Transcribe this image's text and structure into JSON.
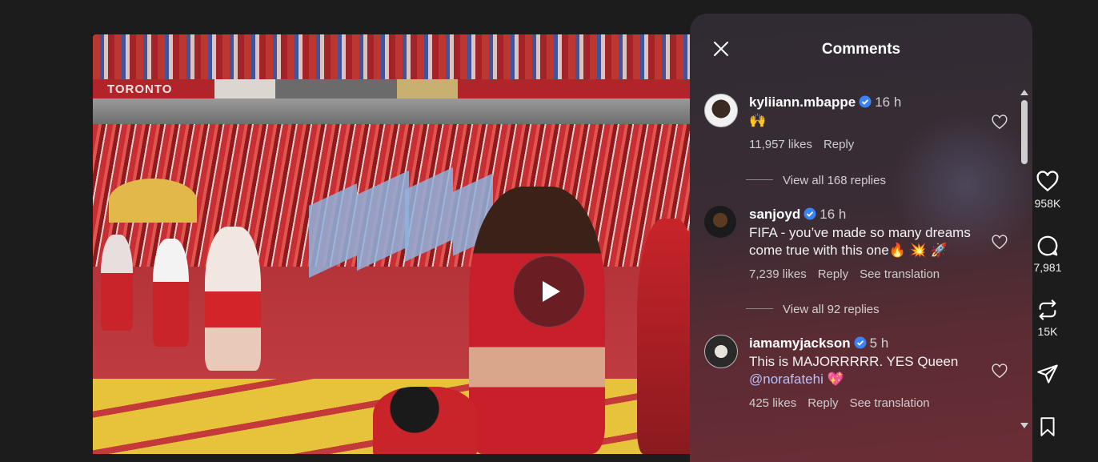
{
  "video": {
    "banner_text": "TORONTO"
  },
  "panel": {
    "title": "Comments"
  },
  "comments": [
    {
      "username": "kyliiann.mbappe",
      "time": "16 h",
      "text": "🙌",
      "likes": "11,957 likes",
      "reply": "Reply",
      "view_replies": "View all 168 replies"
    },
    {
      "username": "sanjoyd",
      "time": "16 h",
      "text": "FIFA - you’ve made so many dreams come true with this one🔥 💥 🚀",
      "likes": "7,239 likes",
      "reply": "Reply",
      "translation": "See translation",
      "view_replies": "View all 92 replies"
    },
    {
      "username": "iamamyjackson",
      "time": "5 h",
      "text": "This is MAJORRRRR. YES Queen ",
      "mention": "@norafatehi",
      "emoji": "💖",
      "likes": "425 likes",
      "reply": "Reply",
      "translation": "See translation"
    }
  ],
  "actions": {
    "like_count": "958K",
    "comment_count": "7,981",
    "repost_count": "15K"
  },
  "icons": [
    "close-icon",
    "play-icon",
    "verified-icon",
    "heart-icon",
    "comment-icon",
    "repost-icon",
    "share-icon",
    "save-icon"
  ],
  "colors": {
    "verified": "#3b82f6",
    "mention": "#b3c0ff"
  }
}
